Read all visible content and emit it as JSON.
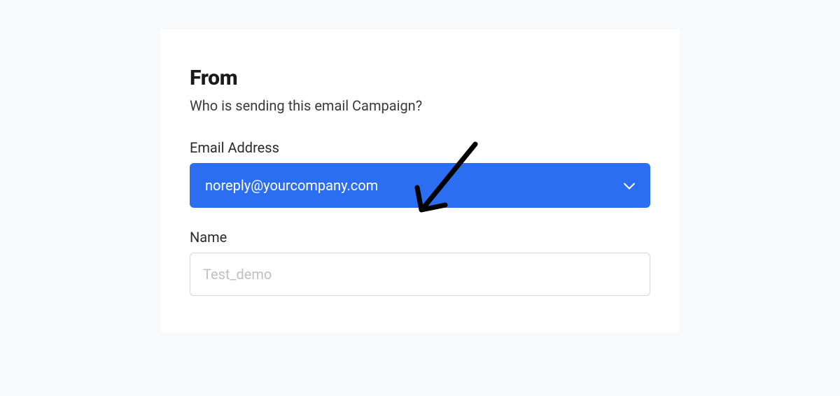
{
  "form": {
    "heading": "From",
    "subtitle": "Who is sending this email Campaign?",
    "emailLabel": "Email Address",
    "emailValue": "noreply@yourcompany.com",
    "nameLabel": "Name",
    "namePlaceholder": "Test_demo"
  },
  "colors": {
    "accent": "#2b6ef2",
    "background": "#f8f9fb",
    "card": "#ffffff",
    "text": "#2a2a2a"
  }
}
